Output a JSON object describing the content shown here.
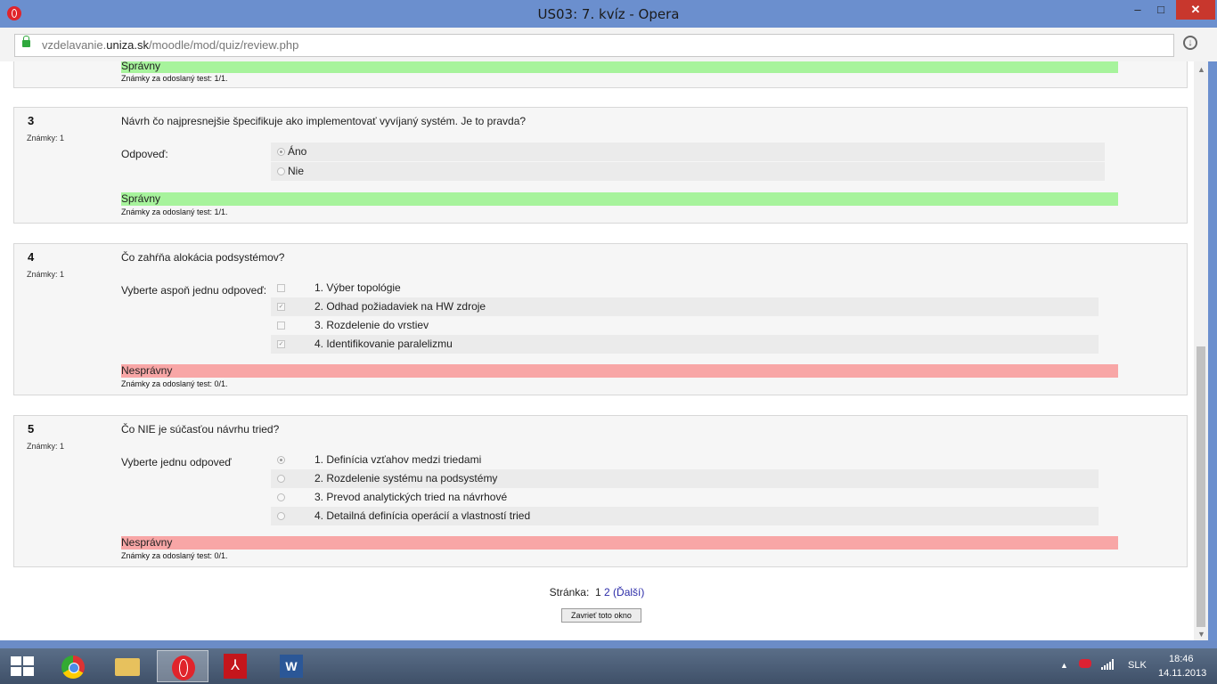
{
  "window": {
    "title": "US03: 7. kvíz - Opera",
    "min": "–",
    "max": "□",
    "close": "✕"
  },
  "address": {
    "host_prefix": "vzdelavanie.",
    "host_main": "uniza.sk",
    "path": "/moodle/mod/quiz/review.php"
  },
  "top_partial": {
    "status": "Správny",
    "score": "Známky za odoslaný test: 1/1."
  },
  "questions": [
    {
      "number": "3",
      "marks": "Známky: 1",
      "text": "Návrh čo najpresnejšie špecifikuje ako implementovať vyvíjaný systém. Je to pravda?",
      "answer_label": "Odpoveď:",
      "options": [
        {
          "label": "Áno",
          "selected": true
        },
        {
          "label": "Nie",
          "selected": false
        }
      ],
      "status": "Správny",
      "status_color": "#a7f39c",
      "score": "Známky za odoslaný test: 1/1."
    },
    {
      "number": "4",
      "marks": "Známky: 1",
      "text": "Čo zahŕňa alokácia podsystémov?",
      "answer_label": "Vyberte aspoň jednu odpoveď:",
      "options": [
        {
          "label": "1. Výber topológie",
          "selected": false
        },
        {
          "label": "2. Odhad požiadaviek na HW zdroje",
          "selected": true
        },
        {
          "label": "3. Rozdelenie do vrstiev",
          "selected": false
        },
        {
          "label": "4. Identifikovanie paralelizmu",
          "selected": true
        }
      ],
      "status": "Nesprávny",
      "status_color": "#f8a6a6",
      "score": "Známky za odoslaný test: 0/1."
    },
    {
      "number": "5",
      "marks": "Známky: 1",
      "text": "Čo NIE je súčasťou návrhu tried?",
      "answer_label": "Vyberte jednu odpoveď",
      "options": [
        {
          "label": "1. Definícia vzťahov medzi triedami",
          "selected": true
        },
        {
          "label": "2. Rozdelenie systému na podsystémy",
          "selected": false
        },
        {
          "label": "3. Prevod analytických tried na návrhové",
          "selected": false
        },
        {
          "label": "4. Detailná definícia operácií a vlastností tried",
          "selected": false
        }
      ],
      "status": "Nesprávny",
      "status_color": "#f8a6a6",
      "score": "Známky za odoslaný test: 0/1."
    }
  ],
  "pager": {
    "label": "Stránka:",
    "page1": "1",
    "page2": "2",
    "next": "(Ďalší)"
  },
  "close_button": "Zavrieť toto okno",
  "taskbar": {
    "apps": [
      "chrome-icon",
      "folder-icon",
      "opera-icon",
      "pdf-icon",
      "word-icon"
    ],
    "word_glyph": "W",
    "lang": "SLK",
    "time": "18:46",
    "date": "14.11.2013"
  }
}
